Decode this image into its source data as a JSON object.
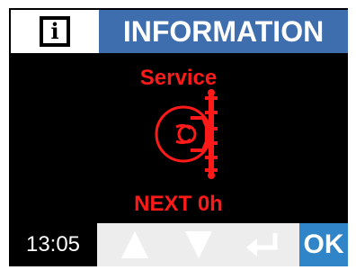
{
  "header": {
    "icon": "info-icon",
    "icon_glyph": "i",
    "title": "INFORMATION",
    "title_bg": "#3E6EAE"
  },
  "body": {
    "title": "Service",
    "graphic": "wheel-service-icon",
    "status": "NEXT 0h",
    "accent_color": "#FF1A1A"
  },
  "footer": {
    "time": "13:05",
    "buttons": [
      {
        "name": "up-arrow-icon"
      },
      {
        "name": "down-arrow-icon"
      },
      {
        "name": "enter-icon"
      }
    ],
    "ok_label": "OK",
    "ok_color": "#2F85C8"
  }
}
